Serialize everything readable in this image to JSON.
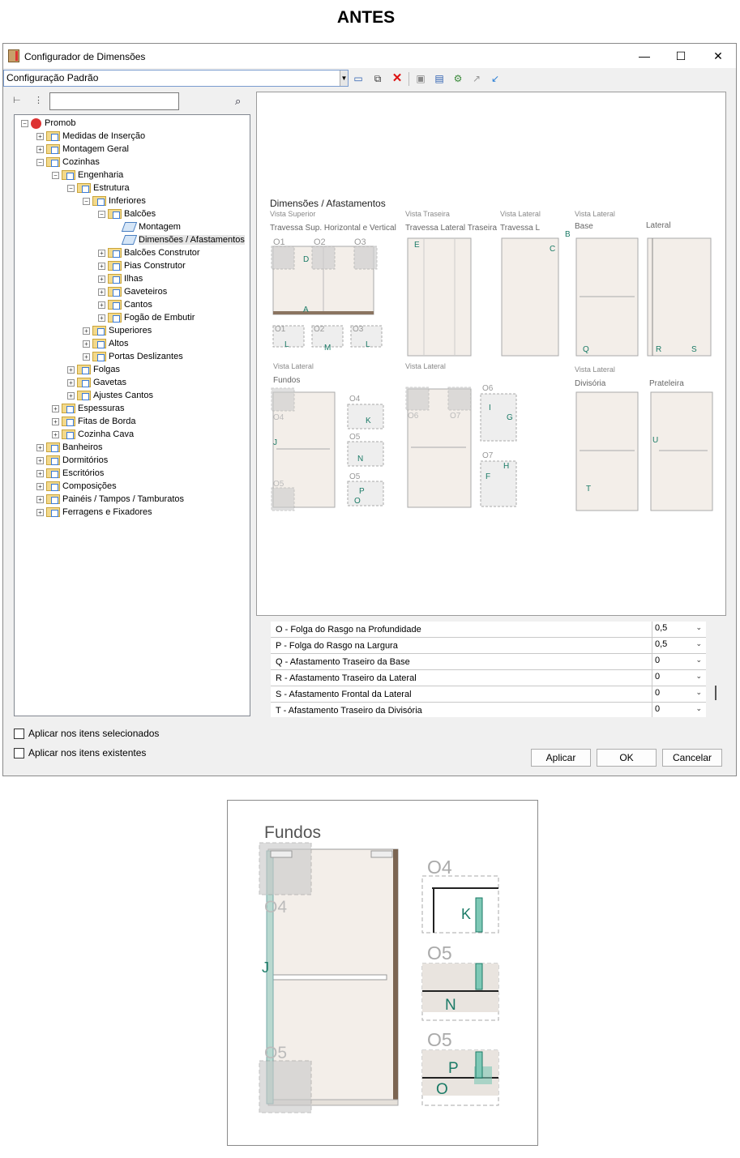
{
  "heading": "ANTES",
  "window": {
    "title": "Configurador de Dimensões",
    "controls": [
      "—",
      "☐",
      "✕"
    ]
  },
  "toolbar": {
    "config_combo": "Configuração Padrão"
  },
  "tree": {
    "items": [
      {
        "label": "Promob",
        "depth": 0,
        "exp": "−",
        "icon": "root"
      },
      {
        "label": "Medidas de Inserção",
        "depth": 1,
        "exp": "+",
        "icon": "folder"
      },
      {
        "label": "Montagem Geral",
        "depth": 1,
        "exp": "+",
        "icon": "folder"
      },
      {
        "label": "Cozinhas",
        "depth": 1,
        "exp": "−",
        "icon": "folder"
      },
      {
        "label": "Engenharia",
        "depth": 2,
        "exp": "−",
        "icon": "folder"
      },
      {
        "label": "Estrutura",
        "depth": 3,
        "exp": "−",
        "icon": "folder"
      },
      {
        "label": "Inferiores",
        "depth": 4,
        "exp": "−",
        "icon": "folder"
      },
      {
        "label": "Balcões",
        "depth": 5,
        "exp": "−",
        "icon": "folder"
      },
      {
        "label": "Montagem",
        "depth": 6,
        "exp": "",
        "icon": "leaf"
      },
      {
        "label": "Dimensões / Afastamentos",
        "depth": 6,
        "exp": "",
        "icon": "leaf",
        "selected": true
      },
      {
        "label": "Balcões Construtor",
        "depth": 5,
        "exp": "+",
        "icon": "folder"
      },
      {
        "label": "Pias Construtor",
        "depth": 5,
        "exp": "+",
        "icon": "folder"
      },
      {
        "label": "Ilhas",
        "depth": 5,
        "exp": "+",
        "icon": "folder"
      },
      {
        "label": "Gaveteiros",
        "depth": 5,
        "exp": "+",
        "icon": "folder"
      },
      {
        "label": "Cantos",
        "depth": 5,
        "exp": "+",
        "icon": "folder"
      },
      {
        "label": "Fogão de Embutir",
        "depth": 5,
        "exp": "+",
        "icon": "folder"
      },
      {
        "label": "Superiores",
        "depth": 4,
        "exp": "+",
        "icon": "folder"
      },
      {
        "label": "Altos",
        "depth": 4,
        "exp": "+",
        "icon": "folder"
      },
      {
        "label": "Portas Deslizantes",
        "depth": 4,
        "exp": "+",
        "icon": "folder"
      },
      {
        "label": "Folgas",
        "depth": 3,
        "exp": "+",
        "icon": "folder"
      },
      {
        "label": "Gavetas",
        "depth": 3,
        "exp": "+",
        "icon": "folder"
      },
      {
        "label": "Ajustes Cantos",
        "depth": 3,
        "exp": "+",
        "icon": "folder"
      },
      {
        "label": "Espessuras",
        "depth": 2,
        "exp": "+",
        "icon": "folder"
      },
      {
        "label": "Fitas de Borda",
        "depth": 2,
        "exp": "+",
        "icon": "folder"
      },
      {
        "label": "Cozinha Cava",
        "depth": 2,
        "exp": "+",
        "icon": "folder"
      },
      {
        "label": "Banheiros",
        "depth": 1,
        "exp": "+",
        "icon": "folder"
      },
      {
        "label": "Dormitórios",
        "depth": 1,
        "exp": "+",
        "icon": "folder"
      },
      {
        "label": "Escritórios",
        "depth": 1,
        "exp": "+",
        "icon": "folder"
      },
      {
        "label": "Composições",
        "depth": 1,
        "exp": "+",
        "icon": "folder"
      },
      {
        "label": "Painéis / Tampos / Tamburatos",
        "depth": 1,
        "exp": "+",
        "icon": "folder"
      },
      {
        "label": "Ferragens e Fixadores",
        "depth": 1,
        "exp": "+",
        "icon": "folder"
      }
    ]
  },
  "diagram": {
    "title": "Dimensões / Afastamentos",
    "vista_superior": "Vista Superior",
    "travessa_sup": "Travessa Sup. Horizontal e Vertical",
    "vista_traseira": "Vista Traseira",
    "travessa_lat": "Travessa Lateral Traseira",
    "vista_lateral_1": "Vista Lateral",
    "travessa_l": "Travessa L",
    "vista_lateral_2": "Vista Lateral",
    "base": "Base",
    "lateral": "Lateral",
    "vista_lateral_3": "Vista Lateral",
    "fundos": "Fundos",
    "vista_lateral_4": "Vista Lateral",
    "vista_lateral_5": "Vista Lateral",
    "divisoria": "Divisória",
    "prateleira": "Prateleira",
    "codes": {
      "o1": "O1",
      "o2": "O2",
      "o3": "O3",
      "o4": "O4",
      "o5": "O5",
      "o6": "O6",
      "o7": "O7"
    },
    "letters": {
      "a": "A",
      "b": "B",
      "c": "C",
      "d": "D",
      "e": "E",
      "f": "F",
      "g": "G",
      "h": "H",
      "i": "I",
      "j": "J",
      "k": "K",
      "l": "L",
      "m": "M",
      "n": "N",
      "o": "O",
      "p": "P",
      "q": "Q",
      "r": "R",
      "s": "S",
      "t": "T",
      "u": "U"
    }
  },
  "properties": [
    {
      "label": "O - Folga do Rasgo na Profundidade",
      "value": "0,5"
    },
    {
      "label": "P - Folga do Rasgo na Largura",
      "value": "0,5"
    },
    {
      "label": "Q - Afastamento Traseiro da Base",
      "value": "0"
    },
    {
      "label": "R - Afastamento Traseiro da Lateral",
      "value": "0"
    },
    {
      "label": "S - Afastamento Frontal da Lateral",
      "value": "0"
    },
    {
      "label": "T - Afastamento Traseiro da Divisória",
      "value": "0"
    }
  ],
  "options": {
    "apply_selected": "Aplicar nos itens selecionados",
    "apply_existing": "Aplicar nos itens existentes"
  },
  "buttons": {
    "apply": "Aplicar",
    "ok": "OK",
    "cancel": "Cancelar"
  },
  "zoom": {
    "fundos": "Fundos",
    "o4a": "O4",
    "o5a": "O5",
    "o4b": "O4",
    "o5b": "O5",
    "o5c": "O5",
    "j": "J",
    "k": "K",
    "n": "N",
    "p": "P",
    "o": "O"
  }
}
